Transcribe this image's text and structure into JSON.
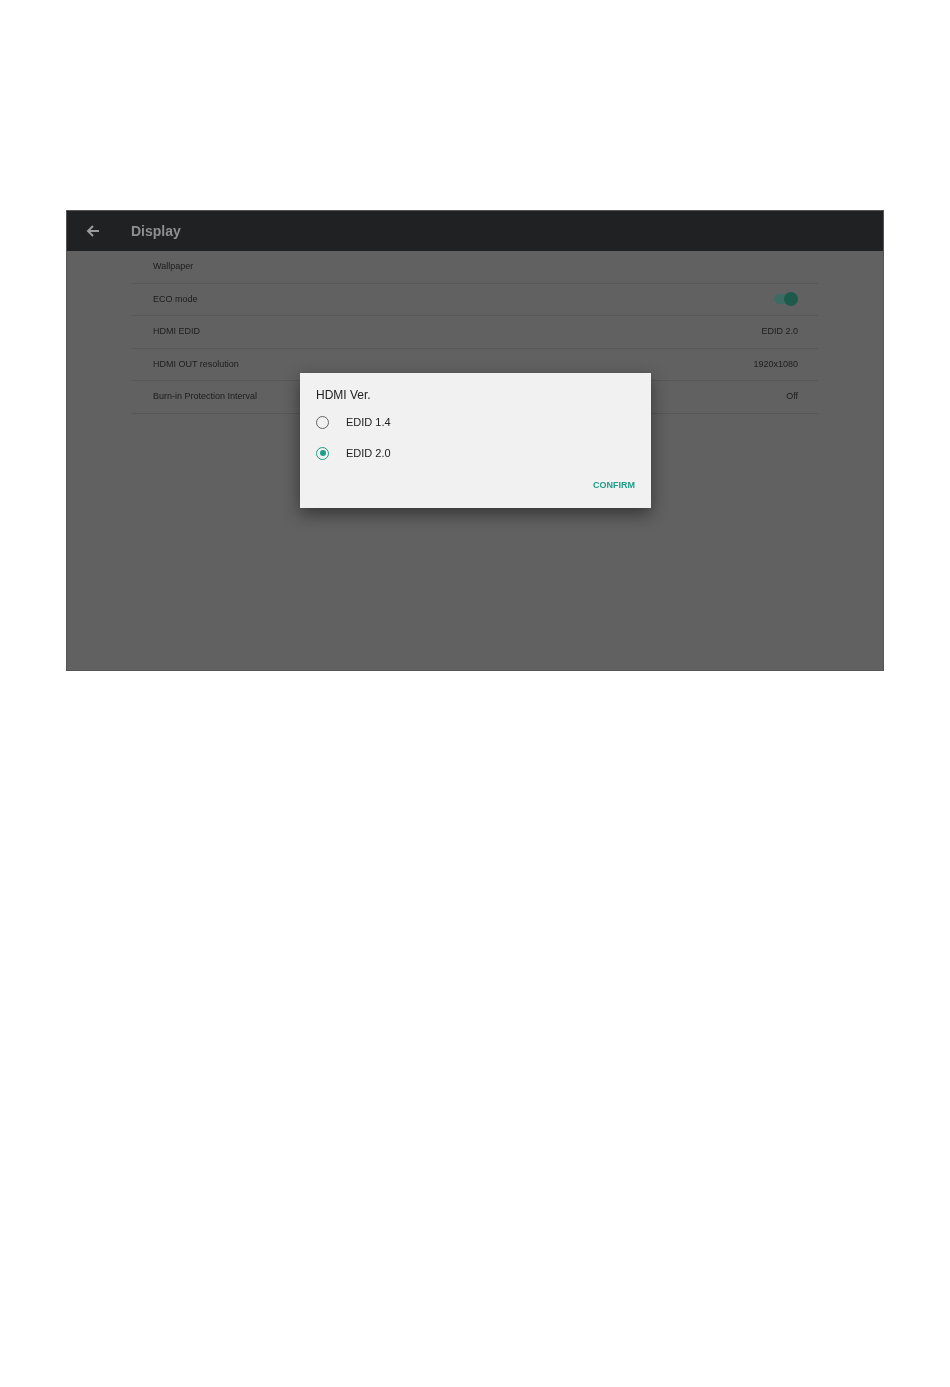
{
  "header": {
    "title": "Display"
  },
  "settings": [
    {
      "kind": "plain",
      "label": "Wallpaper"
    },
    {
      "kind": "toggle",
      "label": "ECO mode",
      "on": true
    },
    {
      "kind": "value",
      "label": "HDMI EDID",
      "value": "EDID 2.0"
    },
    {
      "kind": "value",
      "label": "HDMI OUT resolution",
      "value": "1920x1080"
    },
    {
      "kind": "value",
      "label": "Burn-in Protection Interval",
      "value": "Off"
    }
  ],
  "dialog": {
    "title": "HDMI Ver.",
    "options": [
      {
        "label": "EDID 1.4",
        "selected": false
      },
      {
        "label": "EDID 2.0",
        "selected": true
      }
    ],
    "confirm": "CONFIRM"
  }
}
